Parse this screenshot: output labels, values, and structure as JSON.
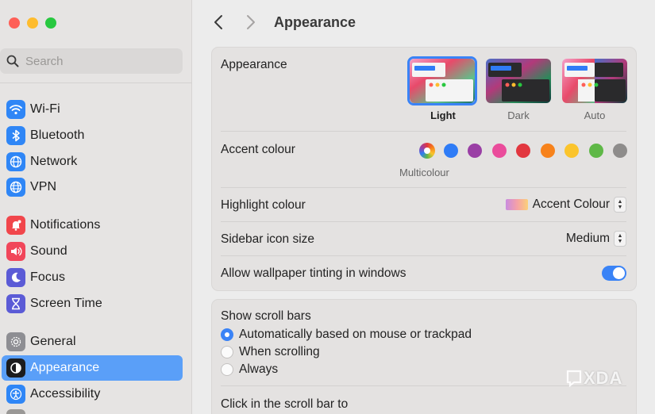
{
  "window": {
    "traffic_lights": {
      "close": "#fe5f57",
      "minimize": "#febc2e",
      "zoom": "#28c840"
    }
  },
  "sidebar": {
    "search_placeholder": "Search",
    "items": [
      {
        "label": "Wi-Fi",
        "icon": "wifi-icon",
        "color": "#2f86f6"
      },
      {
        "label": "Bluetooth",
        "icon": "bluetooth-icon",
        "color": "#2f86f6"
      },
      {
        "label": "Network",
        "icon": "globe-icon",
        "color": "#2f86f6"
      },
      {
        "label": "VPN",
        "icon": "vpn-globe-icon",
        "color": "#2f86f6"
      },
      {
        "label": "Notifications",
        "icon": "bell-icon",
        "color": "#f1464b"
      },
      {
        "label": "Sound",
        "icon": "speaker-icon",
        "color": "#f1465a"
      },
      {
        "label": "Focus",
        "icon": "moon-icon",
        "color": "#5b5bd6"
      },
      {
        "label": "Screen Time",
        "icon": "hourglass-icon",
        "color": "#5b5bd6"
      },
      {
        "label": "General",
        "icon": "gear-icon",
        "color": "#8e8e93"
      },
      {
        "label": "Appearance",
        "icon": "appearance-icon",
        "color": "#1c1c1e",
        "active": true
      },
      {
        "label": "Accessibility",
        "icon": "accessibility-icon",
        "color": "#2f86f6"
      }
    ]
  },
  "header": {
    "title": "Appearance",
    "back": "chevron-left-icon",
    "forward": "chevron-right-icon"
  },
  "appearance": {
    "label": "Appearance",
    "modes": [
      {
        "label": "Light",
        "selected": true
      },
      {
        "label": "Dark",
        "selected": false
      },
      {
        "label": "Auto",
        "selected": false
      }
    ]
  },
  "accent": {
    "label": "Accent colour",
    "selected_name": "Multicolour",
    "colors": [
      "multicolour",
      "#2f7cf6",
      "#9a3fa5",
      "#ea4c9b",
      "#e2373f",
      "#f7821b",
      "#fbc42c",
      "#5fb847",
      "#8e8c8b"
    ]
  },
  "highlight": {
    "label": "Highlight colour",
    "value": "Accent Colour"
  },
  "sidebar_icon_size": {
    "label": "Sidebar icon size",
    "value": "Medium"
  },
  "wallpaper_tinting": {
    "label": "Allow wallpaper tinting in windows",
    "enabled": true
  },
  "scroll_bars": {
    "label": "Show scroll bars",
    "options": [
      {
        "label": "Automatically based on mouse or trackpad",
        "selected": true
      },
      {
        "label": "When scrolling",
        "selected": false
      },
      {
        "label": "Always",
        "selected": false
      }
    ],
    "click_label": "Click in the scroll bar to"
  },
  "watermark": {
    "text": "XDA"
  }
}
